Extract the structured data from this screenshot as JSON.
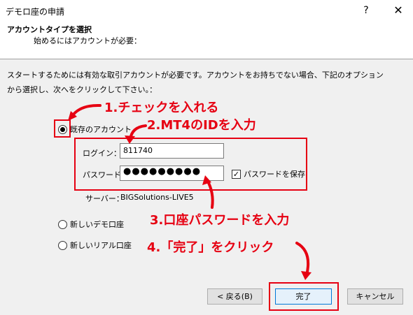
{
  "window": {
    "title": "デモロ座の申請",
    "help_icon": "question-mark-icon",
    "close_icon": "close-icon"
  },
  "header": {
    "title": "アカウントタイプを選択",
    "subtitle": "始めるにはアカウントが必要："
  },
  "instructions": {
    "line1": "スタートするためには有効な取引アカウントが必要です。アカウントをお持ちでない場合、下記のオプション",
    "line2": "から選択し、次へをクリックして下さい。："
  },
  "options": {
    "existing": {
      "label": "既存のアカウント",
      "checked": true
    },
    "new_demo": {
      "label": "新しいデモ口座",
      "checked": false
    },
    "new_real": {
      "label": "新しいリアル口座",
      "checked": false
    }
  },
  "login": {
    "label": "ログイン：",
    "value": "811740"
  },
  "password": {
    "label": "パスワード：",
    "masked": "●●●●●●●●●",
    "save_label": "パスワードを保存",
    "save_checked": true,
    "save_mark": "✓"
  },
  "server": {
    "label": "サーバー：",
    "value": "BIGSolutions-LIVE5"
  },
  "buttons": {
    "back": "< 戻る(B)",
    "finish": "完了",
    "cancel": "キャンセル"
  },
  "annotations": {
    "step1": "1.チェックを入れる",
    "step2": "2.MT4のIDを入力",
    "step3": "3.口座パスワードを入力",
    "step4": "4.「完了」をクリック"
  },
  "colors": {
    "annotation_red": "#e60012",
    "window_bg": "#f0f0f0",
    "focus_blue": "#0078d7"
  }
}
